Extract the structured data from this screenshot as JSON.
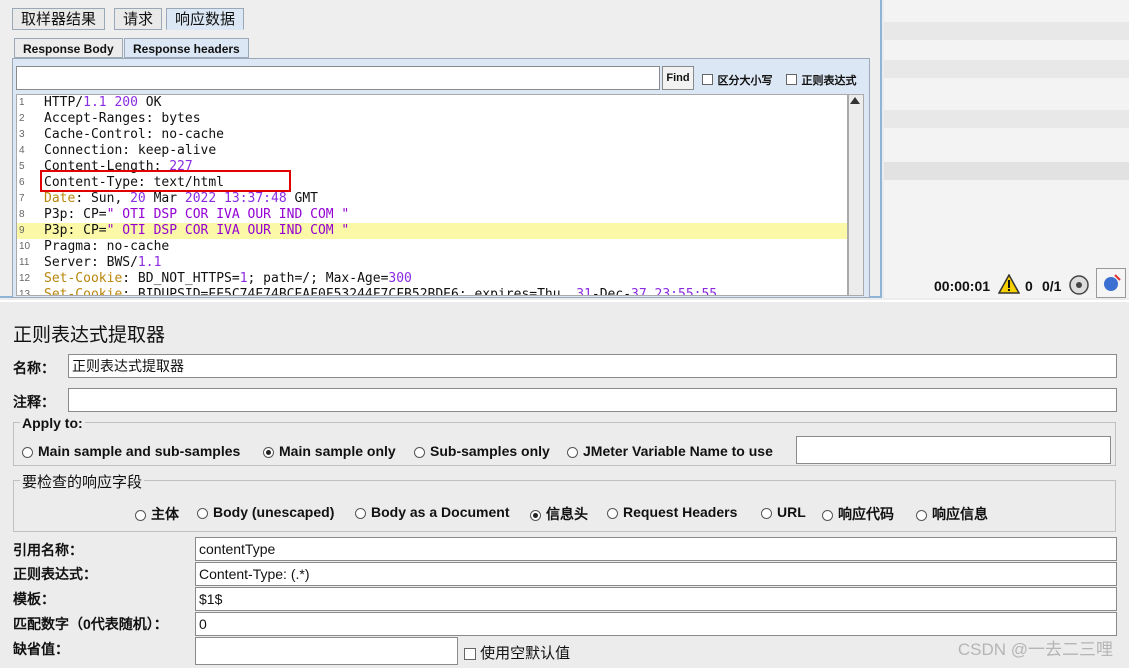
{
  "result_tabs": [
    "取样器结果",
    "请求",
    "响应数据"
  ],
  "response_subtabs": [
    "Response Body",
    "Response headers"
  ],
  "search": {
    "value": "",
    "find_label": "Find",
    "case_label": "区分大小写",
    "regex_label": "正则表达式"
  },
  "header_lines": [
    {
      "n": "1",
      "parts": [
        [
          "HTTP/",
          ""
        ],
        [
          "1.1",
          "num"
        ],
        [
          " ",
          ""
        ],
        [
          "200",
          "num"
        ],
        [
          " OK",
          ""
        ]
      ]
    },
    {
      "n": "2",
      "parts": [
        [
          "Accept-Ranges: bytes",
          ""
        ]
      ]
    },
    {
      "n": "3",
      "parts": [
        [
          "Cache-Control: no-cache",
          ""
        ]
      ]
    },
    {
      "n": "4",
      "parts": [
        [
          "Connection: keep-alive",
          ""
        ]
      ]
    },
    {
      "n": "5",
      "parts": [
        [
          "Content-Length: ",
          ""
        ],
        [
          "227",
          "num"
        ]
      ]
    },
    {
      "n": "6",
      "parts": [
        [
          "Content-Type: text/html",
          ""
        ]
      ]
    },
    {
      "n": "7",
      "parts": [
        [
          "Date",
          "key"
        ],
        [
          ": Sun, ",
          ""
        ],
        [
          "20",
          "num"
        ],
        [
          " Mar ",
          ""
        ],
        [
          "2022",
          "num"
        ],
        [
          " ",
          ""
        ],
        [
          "13:37:48",
          "num"
        ],
        [
          " GMT",
          ""
        ]
      ]
    },
    {
      "n": "8",
      "parts": [
        [
          "P3p: CP=",
          ""
        ],
        [
          "\" OTI DSP COR IVA OUR IND COM \"",
          "str"
        ]
      ]
    },
    {
      "n": "9",
      "parts": [
        [
          "P3p: CP=",
          ""
        ],
        [
          "\" OTI DSP COR IVA OUR IND COM \"",
          "str"
        ]
      ],
      "highlight": true
    },
    {
      "n": "10",
      "parts": [
        [
          "Pragma: no-cache",
          ""
        ]
      ]
    },
    {
      "n": "11",
      "parts": [
        [
          "Server: BWS/",
          ""
        ],
        [
          "1.1",
          "num"
        ]
      ]
    },
    {
      "n": "12",
      "parts": [
        [
          "Set-Cookie",
          "key"
        ],
        [
          ": BD_NOT_HTTPS=",
          ""
        ],
        [
          "1",
          "num"
        ],
        [
          "; path=/; Max-Age=",
          ""
        ],
        [
          "300",
          "num"
        ]
      ]
    },
    {
      "n": "13",
      "parts": [
        [
          "Set-Cookie",
          "key"
        ],
        [
          ": BIDUPSID=EE5C74E74BCEAF0F53244F7CFB52BDE6; expires=Thu, ",
          ""
        ],
        [
          "31",
          "num"
        ],
        [
          "-Dec-",
          ""
        ],
        [
          "37",
          "num"
        ],
        [
          " ",
          ""
        ],
        [
          "23:55:55",
          "num"
        ]
      ]
    }
  ],
  "status": {
    "elapsed": "00:00:01",
    "warnings": "0",
    "threads": "0/1"
  },
  "form": {
    "title": "正则表达式提取器",
    "name_label": "名称：",
    "name_value": "正则表达式提取器",
    "comment_label": "注释：",
    "comment_value": "",
    "apply_to_label": "Apply to:",
    "apply_options": [
      "Main sample and sub-samples",
      "Main sample only",
      "Sub-samples only",
      "JMeter Variable Name to use"
    ],
    "apply_selected": 1,
    "jmeter_var_value": "",
    "field_check_label": "要检查的响应字段",
    "field_options": [
      "主体",
      "Body (unescaped)",
      "Body as a Document",
      "信息头",
      "Request Headers",
      "URL",
      "响应代码",
      "响应信息"
    ],
    "field_selected": 3,
    "ref_name_label": "引用名称：",
    "ref_name_value": "contentType",
    "regex_label": "正则表达式：",
    "regex_value": "Content-Type: (.*)",
    "template_label": "模板：",
    "template_value": "$1$",
    "match_no_label": "匹配数字（0代表随机）：",
    "match_no_value": "0",
    "default_label": "缺省值：",
    "default_value": "",
    "use_empty_default_label": "使用空默认值"
  },
  "watermark": "CSDN @一去二三哩"
}
